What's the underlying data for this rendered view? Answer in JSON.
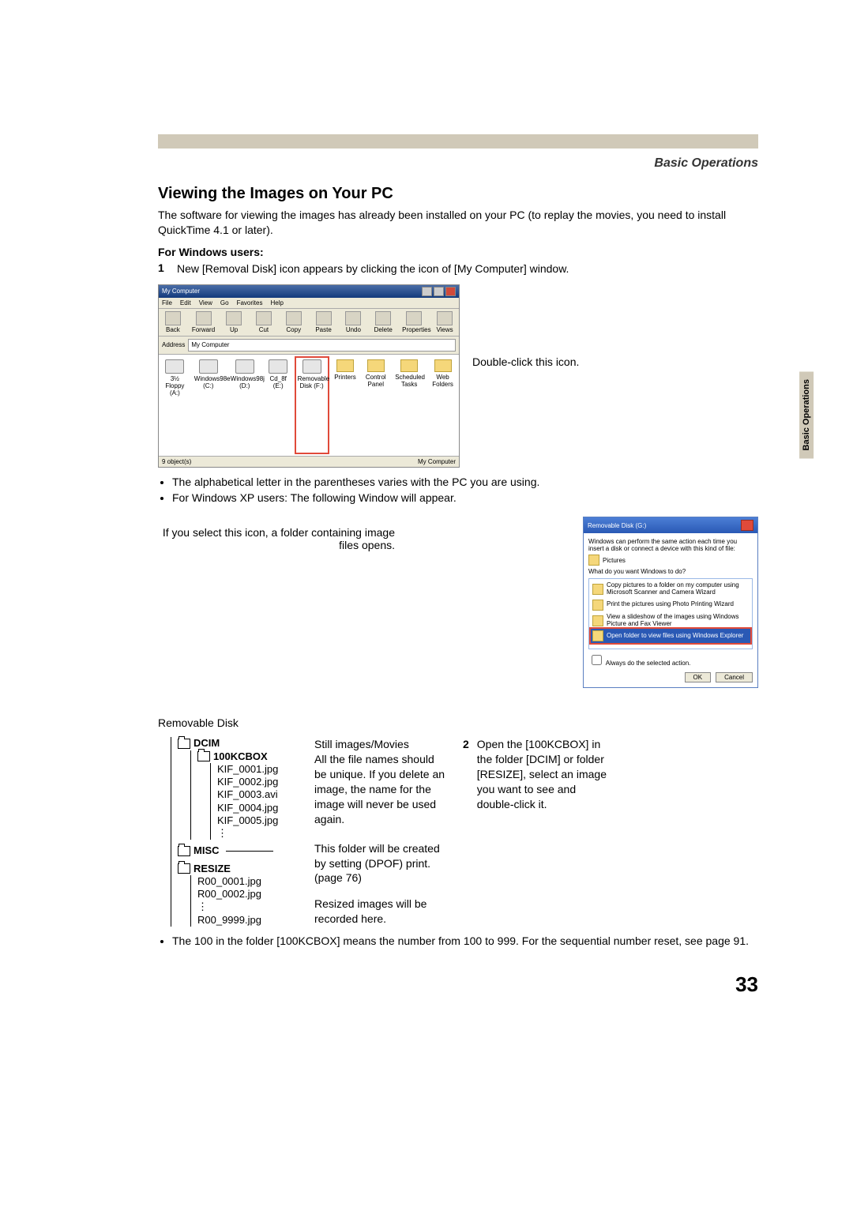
{
  "section_header": "Basic Operations",
  "side_tab": "Basic\nOperations",
  "title": "Viewing the Images on Your PC",
  "intro": "The software for viewing the images has already been installed on your PC (to replay the movies, you need to install QuickTime 4.1 or later).",
  "sub_win": "For Windows users:",
  "step1_num": "1",
  "step1": "New [Removal Disk] icon appears by clicking the icon of [My Computer] window.",
  "mc": {
    "title": "My Computer",
    "menu": [
      "File",
      "Edit",
      "View",
      "Go",
      "Favorites",
      "Help"
    ],
    "tb": [
      "Back",
      "Forward",
      "Up",
      "Cut",
      "Copy",
      "Paste",
      "Undo",
      "Delete",
      "Properties",
      "Views"
    ],
    "addr_label": "Address",
    "addr_value": "My Computer",
    "items": [
      "3½ Floppy (A:)",
      "Windows98e (C:)",
      "Windows98j (D:)",
      "Cd_8f (E:)",
      "Removable Disk (F:)",
      "Printers",
      "Control Panel",
      "Scheduled Tasks",
      "Web Folders"
    ],
    "status_left": "9 object(s)",
    "status_right": "My Computer"
  },
  "callout1": "Double-click this icon.",
  "bullets": [
    "The alphabetical letter in the parentheses varies with the PC you are using.",
    "For Windows XP users: The following Window will appear."
  ],
  "explain_icon": "If you select this icon, a folder containing image files opens.",
  "xp": {
    "title": "Removable Disk (G:)",
    "desc": "Windows can perform the same action each time you insert a disk or connect a device with this kind of file:",
    "type": "Pictures",
    "prompt": "What do you want Windows to do?",
    "items": [
      "Copy pictures to a folder on my computer using Microsoft Scanner and Camera Wizard",
      "Print the pictures using Photo Printing Wizard",
      "View a slideshow of the images using Windows Picture and Fax Viewer",
      "Open folder to view files using Windows Explorer"
    ],
    "check": "Always do the selected action.",
    "ok": "OK",
    "cancel": "Cancel"
  },
  "rem_label": "Removable Disk",
  "tree": {
    "dcim": "DCIM",
    "box": "100KCBOX",
    "files": [
      "KIF_0001.jpg",
      "KIF_0002.jpg",
      "KIF_0003.avi",
      "KIF_0004.jpg",
      "KIF_0005.jpg"
    ],
    "misc": "MISC",
    "resize": "RESIZE",
    "rfiles": [
      "R00_0001.jpg",
      "R00_0002.jpg"
    ],
    "rlast": "R00_9999.jpg"
  },
  "notes": {
    "still": "Still images/Movies\nAll the file names should be unique. If you delete an image, the name for the image will never be used again.",
    "misc": "This folder will be created by setting (DPOF) print. (page 76)",
    "resize": "Resized images will be recorded here."
  },
  "step2_num": "2",
  "step2": "Open the [100KCBOX] in the folder [DCIM] or folder [RESIZE], select an image you want to see and double-click it.",
  "foot_bullet": "The 100 in the folder [100KCBOX] means the number from 100 to 999. For the sequential number reset, see page 91.",
  "page_number": "33"
}
